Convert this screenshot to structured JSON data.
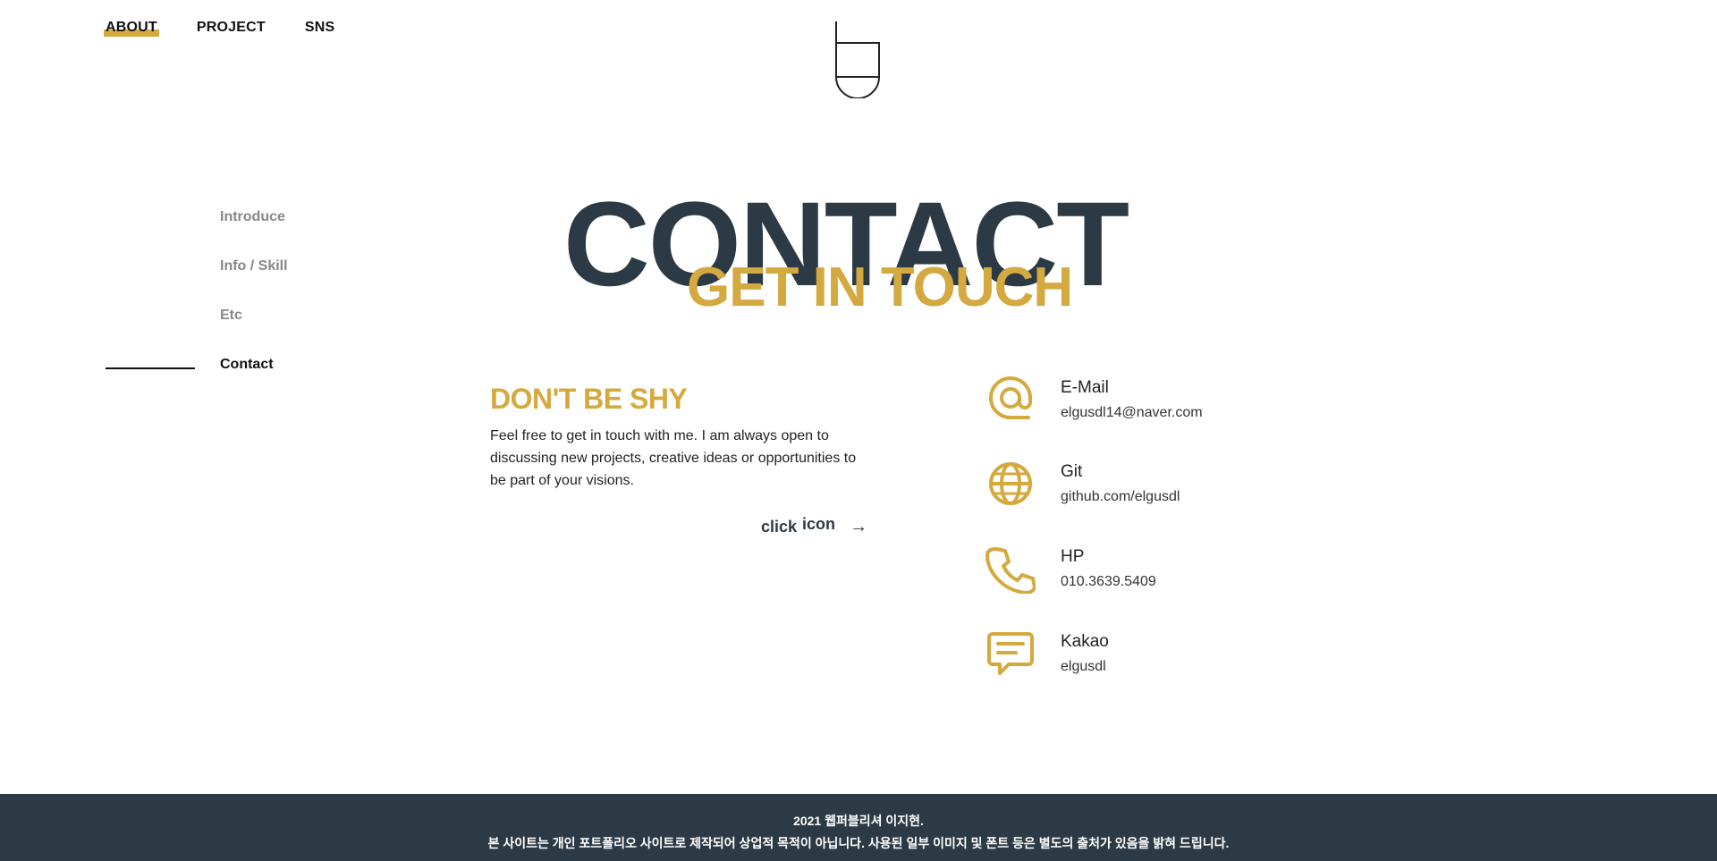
{
  "nav": {
    "items": [
      "ABOUT",
      "PROJECT",
      "SNS"
    ],
    "active": "ABOUT"
  },
  "sidenav": {
    "items": [
      "Introduce",
      "Info / Skill",
      "Etc",
      "Contact"
    ],
    "current": "Contact"
  },
  "hero": {
    "title": "CONTACT",
    "subtitle": "GET IN TOUCH"
  },
  "about": {
    "title": "DON'T BE SHY",
    "text": "Feel free to get in touch with me. I am always open to discussing new projects, creative ideas or opportunities to be part of your visions.",
    "click_label": "click",
    "icon_label": "icon",
    "arrow": "→"
  },
  "contacts": [
    {
      "icon": "at-icon",
      "label": "E-Mail",
      "value": "elgusdl14@naver.com"
    },
    {
      "icon": "globe-icon",
      "label": "Git",
      "value": "github.com/elgusdl"
    },
    {
      "icon": "phone-icon",
      "label": "HP",
      "value": "010.3639.5409"
    },
    {
      "icon": "chat-icon",
      "label": "Kakao",
      "value": "elgusdl"
    }
  ],
  "footer": {
    "line1": "2021 웹퍼블리셔 이지현.",
    "line2": "본 사이트는 개인 포트폴리오 사이트로 제작되어 상업적 목적이 아닙니다. 사용된 일부 이미지 및 폰트 등은 별도의 출처가 있음을 밝혀 드립니다."
  },
  "colors": {
    "accent": "#d4a940",
    "dark": "#2b3a44"
  }
}
